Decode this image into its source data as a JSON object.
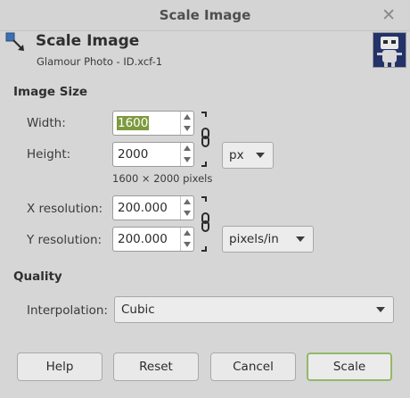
{
  "window": {
    "title": "Scale Image"
  },
  "header": {
    "title": "Scale Image",
    "subtitle": "Glamour Photo - ID.xcf-1"
  },
  "image_size": {
    "heading": "Image Size",
    "width_label": "Width:",
    "width_value": "1600",
    "height_label": "Height:",
    "height_value": "2000",
    "size_unit": "px",
    "pixel_summary": "1600 × 2000 pixels",
    "xres_label": "X resolution:",
    "xres_value": "200.000",
    "yres_label": "Y resolution:",
    "yres_value": "200.000",
    "res_unit": "pixels/in"
  },
  "quality": {
    "heading": "Quality",
    "interp_label": "Interpolation:",
    "interp_value": "Cubic"
  },
  "buttons": {
    "help": "Help",
    "reset": "Reset",
    "cancel": "Cancel",
    "scale": "Scale"
  },
  "colors": {
    "accent": "#93b968",
    "selection": "#7e9a3f",
    "background": "#d6d6d6"
  },
  "icons": [
    "scale-image-icon",
    "close-icon",
    "image-thumbnail",
    "chain-link-icon",
    "spin-up-icon",
    "spin-down-icon",
    "dropdown-arrow-icon"
  ]
}
